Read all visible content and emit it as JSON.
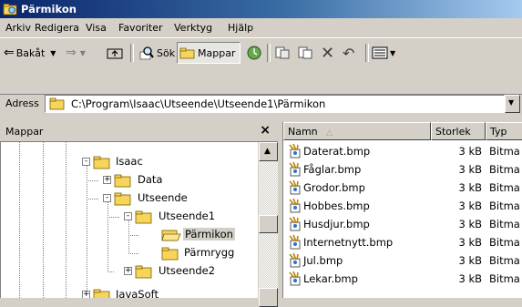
{
  "window": {
    "title": "Pärmikon"
  },
  "menu": [
    "Arkiv",
    "Redigera",
    "Visa",
    "Favoriter",
    "Verktyg",
    "Hjälp"
  ],
  "toolbar": {
    "back_label": "Bakåt",
    "search_label": "Sök",
    "folders_label": "Mappar"
  },
  "address": {
    "label": "Adress",
    "value": "C:\\Program\\Isaac\\Utseende\\Utseende1\\Pärmikon"
  },
  "folder_pane": {
    "title": "Mappar",
    "close_label": "×",
    "tree": [
      {
        "label": "Isaac",
        "expander": "-",
        "selected": false
      },
      {
        "label": "Data",
        "expander": "+",
        "selected": false
      },
      {
        "label": "Utseende",
        "expander": "-",
        "selected": false
      },
      {
        "label": "Utseende1",
        "expander": "-",
        "selected": false
      },
      {
        "label": "Pärmikon",
        "expander": "",
        "selected": true
      },
      {
        "label": "Pärmrygg",
        "expander": "",
        "selected": false
      },
      {
        "label": "Utseende2",
        "expander": "+",
        "selected": false
      },
      {
        "label": "JavaSoft",
        "expander": "+",
        "selected": false
      }
    ]
  },
  "file_list": {
    "columns": {
      "name": "Namn",
      "size": "Storlek",
      "type": "Typ"
    },
    "rows": [
      {
        "name": "Daterat.bmp",
        "size": "3 kB",
        "type": "Bitma"
      },
      {
        "name": "Fåglar.bmp",
        "size": "3 kB",
        "type": "Bitma"
      },
      {
        "name": "Grodor.bmp",
        "size": "3 kB",
        "type": "Bitma"
      },
      {
        "name": "Hobbes.bmp",
        "size": "3 kB",
        "type": "Bitma"
      },
      {
        "name": "Husdjur.bmp",
        "size": "3 kB",
        "type": "Bitma"
      },
      {
        "name": "Internetnytt.bmp",
        "size": "3 kB",
        "type": "Bitma"
      },
      {
        "name": "Jul.bmp",
        "size": "3 kB",
        "type": "Bitma"
      },
      {
        "name": "Lekar.bmp",
        "size": "3 kB",
        "type": "Bitma"
      }
    ]
  },
  "colors": {
    "title_gradient_start": "#0a246a",
    "title_gradient_end": "#a6caf0",
    "face": "#d4d0c8",
    "folder_yellow": "#f7d55a"
  }
}
